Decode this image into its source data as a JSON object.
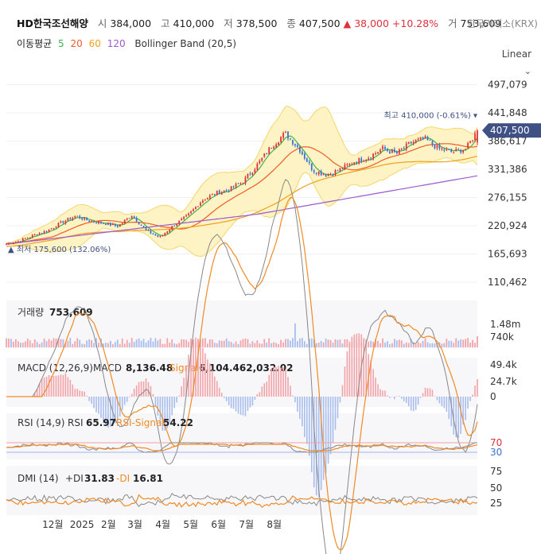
{
  "header": {
    "name": "HD한국조선해양",
    "open_label": "시",
    "open": "384,000",
    "high_label": "고",
    "high": "410,000",
    "low_label": "저",
    "low": "378,500",
    "close_label": "종",
    "close": "407,500",
    "change_arrow": "▲",
    "change": "38,000",
    "change_pct": "+10.28%",
    "volume_label": "거",
    "volume": "753,609",
    "exchange": "한국거래소(KRX)"
  },
  "moving_average": {
    "label": "이동평균",
    "periods": [
      {
        "period": "5",
        "color": "#3cb44b"
      },
      {
        "period": "20",
        "color": "#f05a28"
      },
      {
        "period": "60",
        "color": "#f0a020"
      },
      {
        "period": "120",
        "color": "#9b59d0"
      }
    ],
    "bollinger_label": "Bollinger Band (20,5)"
  },
  "scale_mode": "Linear",
  "colors": {
    "up": "#e0303a",
    "down": "#3b6fd6",
    "band_fill": "#fdf3c4",
    "band_line": "#f5d76a",
    "current_tag": "#3f5085"
  },
  "chart_data": [
    {
      "type": "candlestick",
      "y_ticks": [
        110462,
        165693,
        220924,
        276155,
        331386,
        386617,
        441848,
        497079
      ],
      "y_tick_labels": [
        "110,462",
        "165,693",
        "220,924",
        "276,155",
        "331,386",
        "386,617",
        "441,848",
        "497,079"
      ],
      "ylim": [
        95000,
        515000
      ],
      "current_price_label": "407,500",
      "high_marker": "최고 410,000 (-0.61%) ▾",
      "low_marker": "▲ 최저 175,600 (132.06%)",
      "x_labels": [
        "12월",
        "2025",
        "2월",
        "3월",
        "4월",
        "5월",
        "6월",
        "7월",
        "8월"
      ],
      "close_series": [
        {
          "m": 0.0,
          "v": 186000
        },
        {
          "m": 0.5,
          "v": 192000
        },
        {
          "m": 1.0,
          "v": 203000
        },
        {
          "m": 1.5,
          "v": 212000
        },
        {
          "m": 2.0,
          "v": 228000
        },
        {
          "m": 2.5,
          "v": 240000
        },
        {
          "m": 3.0,
          "v": 230000
        },
        {
          "m": 3.5,
          "v": 226000
        },
        {
          "m": 4.0,
          "v": 220000
        },
        {
          "m": 4.5,
          "v": 242000
        },
        {
          "m": 5.0,
          "v": 212000
        },
        {
          "m": 5.5,
          "v": 198000
        },
        {
          "m": 6.0,
          "v": 222000
        },
        {
          "m": 6.5,
          "v": 240000
        },
        {
          "m": 7.0,
          "v": 270000
        },
        {
          "m": 7.5,
          "v": 285000
        },
        {
          "m": 8.0,
          "v": 292000
        },
        {
          "m": 8.5,
          "v": 308000
        },
        {
          "m": 9.0,
          "v": 340000
        },
        {
          "m": 9.5,
          "v": 376000
        },
        {
          "m": 10.0,
          "v": 402000
        },
        {
          "m": 10.5,
          "v": 372000
        },
        {
          "m": 11.0,
          "v": 330000
        },
        {
          "m": 11.5,
          "v": 320000
        },
        {
          "m": 12.0,
          "v": 332000
        },
        {
          "m": 12.5,
          "v": 347000
        },
        {
          "m": 13.0,
          "v": 355000
        },
        {
          "m": 13.5,
          "v": 372000
        },
        {
          "m": 14.0,
          "v": 362000
        },
        {
          "m": 14.5,
          "v": 383000
        },
        {
          "m": 15.0,
          "v": 392000
        },
        {
          "m": 15.5,
          "v": 372000
        },
        {
          "m": 16.0,
          "v": 365000
        },
        {
          "m": 16.5,
          "v": 372000
        },
        {
          "m": 16.9,
          "v": 407500
        }
      ]
    },
    {
      "type": "bar",
      "title": "거래량",
      "value_label": "753,609",
      "y_tick_labels": [
        "1.48m",
        "740k"
      ]
    },
    {
      "type": "line",
      "title": "MACD (12,26,9)",
      "series": [
        {
          "name": "MACD",
          "value": "8,136.48"
        },
        {
          "name": "Signal",
          "value": "6,104.462,032.02"
        }
      ],
      "y_tick_labels": [
        "49.4k",
        "24.7k",
        "0"
      ]
    },
    {
      "type": "line",
      "title": "RSI (14,9)",
      "series": [
        {
          "name": "RSI",
          "value": "65.97"
        },
        {
          "name": "RSI-Signal",
          "value": "54.22"
        }
      ],
      "y_tick_labels": [
        "70",
        "30"
      ]
    },
    {
      "type": "line",
      "title": "DMI (14)",
      "series": [
        {
          "name": "+DI",
          "value": "31.83"
        },
        {
          "name": "-DI",
          "value": "16.81"
        }
      ],
      "y_tick_labels": [
        "75",
        "50",
        "25"
      ]
    }
  ]
}
